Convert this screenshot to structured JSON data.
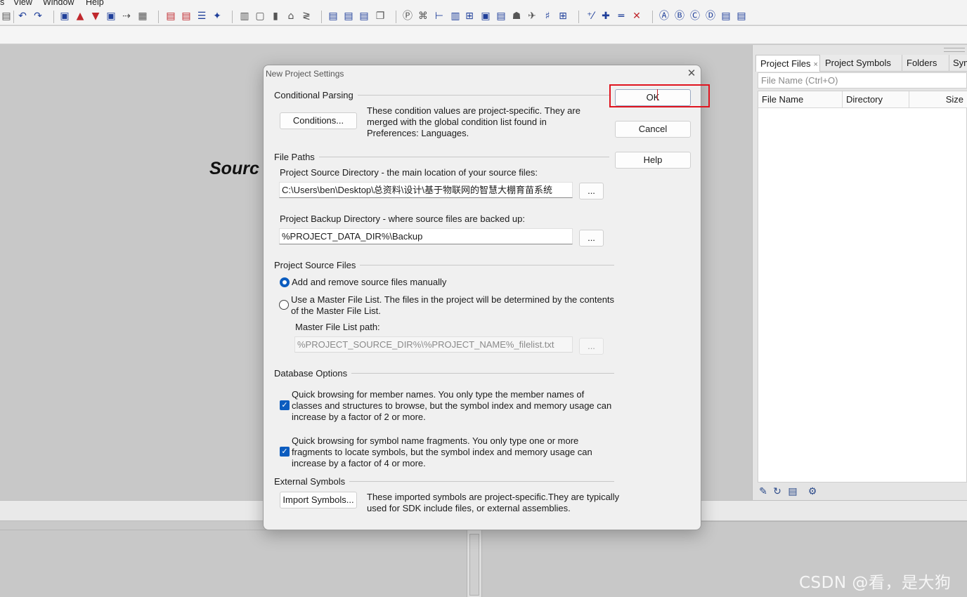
{
  "menu": {
    "items": [
      "s",
      "View",
      "Window",
      "Help"
    ]
  },
  "toolbar": {
    "icons": [
      "paste-icon",
      "undo-icon",
      "redo-icon",
      "new-file-icon",
      "open-icon",
      "save-icon",
      "save-all-icon",
      "jump-icon",
      "browse-icon",
      "bookmark-prev-icon",
      "bookmark-next-icon",
      "list-icon",
      "star-icon",
      "project-icon",
      "window-icon",
      "book-icon",
      "chart-icon",
      "tool-icon",
      "layout-icon",
      "layout2-icon",
      "layout3-icon",
      "windows-icon",
      "p-icon",
      "relation-icon",
      "tree-icon",
      "symbol-icon",
      "context-icon",
      "clip-icon",
      "doc-icon",
      "bird-icon",
      "pin-icon",
      "grid-icon",
      "plus-icon",
      "add-icon",
      "minus-icon",
      "close-icon",
      "a-icon",
      "b-icon",
      "c-icon",
      "d-icon",
      "e-icon",
      "f-icon"
    ]
  },
  "editor": {
    "source_label": "Sourc"
  },
  "right_panel": {
    "tabs": [
      {
        "label": "Project Files",
        "active": true,
        "closable": "×"
      },
      {
        "label": "Project Symbols"
      },
      {
        "label": "Folders"
      },
      {
        "label": "Sym"
      }
    ],
    "search_placeholder": "File Name (Ctrl+O)",
    "columns": [
      "File Name",
      "Directory",
      "Size"
    ],
    "bottom_icons": [
      "edit-icon",
      "refresh-icon",
      "list-icon",
      "settings-icon"
    ]
  },
  "dialog": {
    "title": "New Project Settings",
    "close_glyph": "✕",
    "buttons": {
      "ok": "OK",
      "cancel": "Cancel",
      "help": "Help"
    },
    "conditional_parsing": {
      "label": "Conditional Parsing",
      "button": "Conditions...",
      "description": "These condition values are project-specific.  They are merged with the global condition list found in Preferences: Languages."
    },
    "file_paths": {
      "label": "File Paths",
      "source_dir_label": "Project Source Directory - the main location of your source files:",
      "source_dir_value": "C:\\Users\\ben\\Desktop\\总资料\\设计\\基于物联网的智慧大棚育苗系统",
      "backup_dir_label": "Project Backup Directory - where source files are backed up:",
      "backup_dir_value": "%PROJECT_DATA_DIR%\\Backup",
      "browse": "..."
    },
    "source_files": {
      "label": "Project Source Files",
      "option_manual": "Add and remove source files manually",
      "option_master": "Use a Master File List. The files in the project will be determined by the contents of the Master File List.",
      "selected": "manual",
      "master_path_label": "Master File List path:",
      "master_path_value": "%PROJECT_SOURCE_DIR%\\%PROJECT_NAME%_filelist.txt",
      "browse": "..."
    },
    "database": {
      "label": "Database Options",
      "option_members": "Quick browsing for member names.  You only type the member names of classes and structures to browse, but the symbol index and memory usage can increase by a factor of 2 or more.",
      "option_members_checked": true,
      "option_fragments": "Quick browsing for symbol name fragments.  You only type one or more fragments to locate symbols, but the symbol index and memory usage can increase by a factor of 4 or more.",
      "option_fragments_checked": true
    },
    "external": {
      "label": "External Symbols",
      "button": "Import Symbols...",
      "description": "These imported symbols are project-specific.They are typically used for SDK include files, or external assemblies."
    }
  },
  "watermark": "CSDN @看，是大狗",
  "colors": {
    "accent": "#0b5cbf",
    "highlight": "#e0141f",
    "background": "#c9c9c9"
  }
}
